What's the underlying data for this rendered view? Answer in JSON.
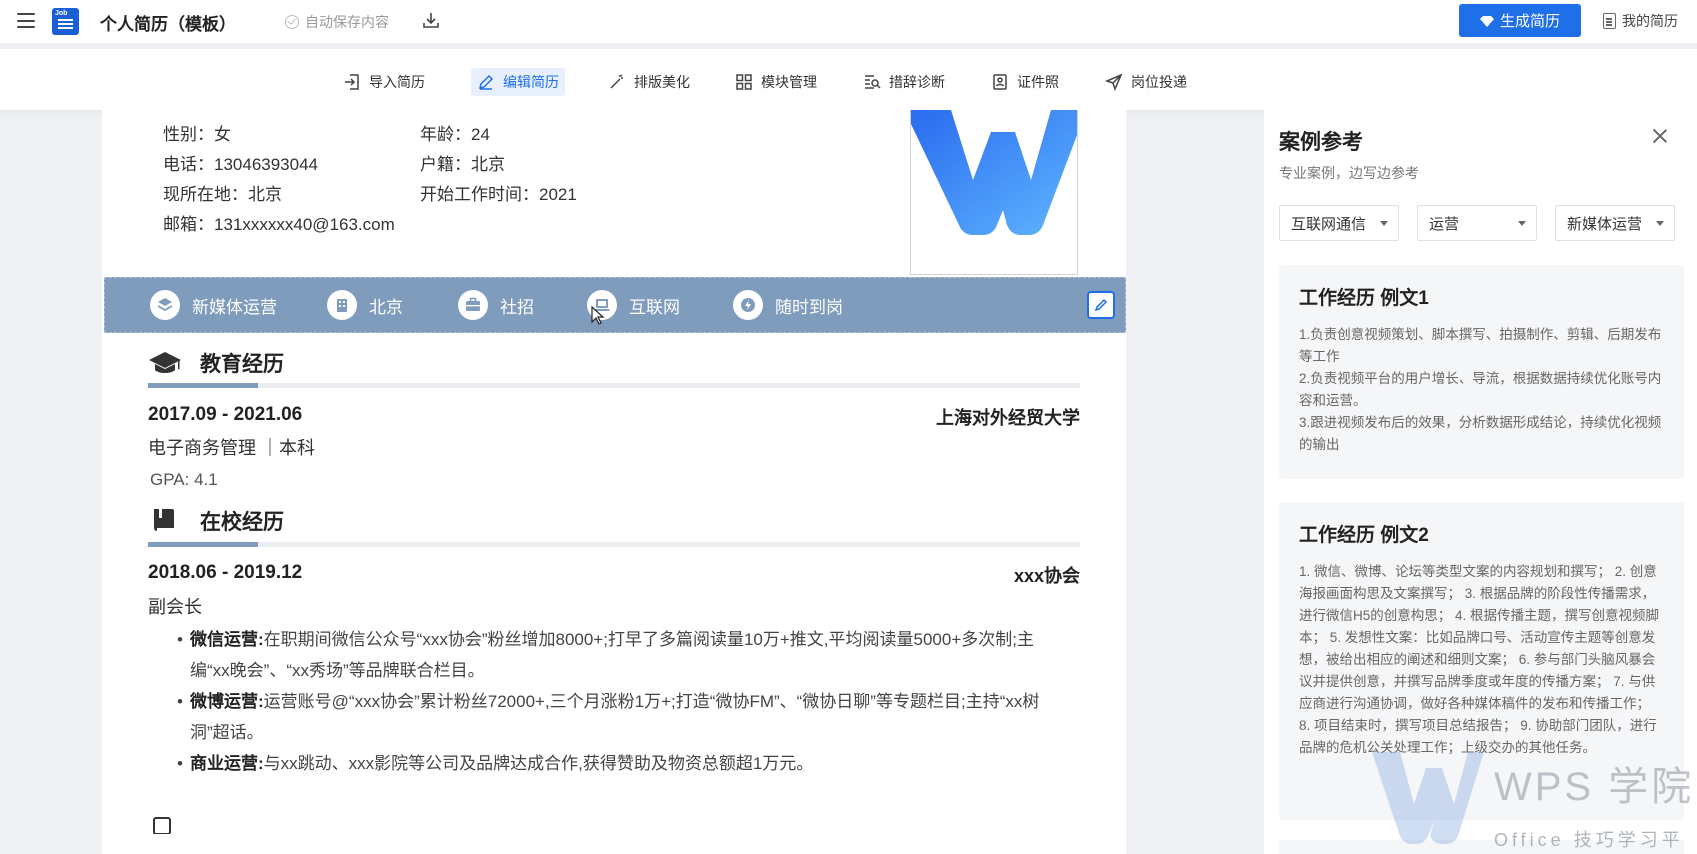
{
  "header": {
    "logo_text": "Job",
    "title": "个人简历（模板）",
    "autosave": "自动保存内容",
    "generate_label": "生成简历",
    "my_resume_label": "我的简历"
  },
  "toolbar": {
    "items": [
      {
        "label": "导入简历",
        "icon": "import-icon"
      },
      {
        "label": "编辑简历",
        "icon": "pencil-icon",
        "active": true
      },
      {
        "label": "排版美化",
        "icon": "magic-wand-icon"
      },
      {
        "label": "模块管理",
        "icon": "grid-icon"
      },
      {
        "label": "措辞诊断",
        "icon": "diagnose-icon"
      },
      {
        "label": "证件照",
        "icon": "id-photo-icon"
      },
      {
        "label": "岗位投递",
        "icon": "send-icon"
      }
    ]
  },
  "profile": {
    "gender": "性别：女",
    "age": "年龄：24",
    "phone": "电话：13046393044",
    "hometown": "户籍：北京",
    "location": "现所在地：北京",
    "work_start": "开始工作时间：2021",
    "email": "邮箱：131xxxxxx40@163.com"
  },
  "tags": [
    {
      "label": "新媒体运营",
      "icon": "layers-icon"
    },
    {
      "label": "北京",
      "icon": "building-icon"
    },
    {
      "label": "社招",
      "icon": "briefcase-icon"
    },
    {
      "label": "互联网",
      "icon": "laptop-icon"
    },
    {
      "label": "随时到岗",
      "icon": "lightning-icon"
    }
  ],
  "education": {
    "title": "教育经历",
    "date": "2017.09  -  2021.06",
    "school": "上海对外经贸大学",
    "major": "电子商务管理  ｜本科",
    "gpa": "GPA: 4.1"
  },
  "campus": {
    "title": "在校经历",
    "date": "2018.06  -  2019.12",
    "org": "xxx协会",
    "role": "副会长",
    "bullets": [
      {
        "head": "微信运营:",
        "text": "在职期间微信公众号“xxx协会”粉丝增加8000+;打早了多篇阅读量10万+推文,平均阅读量5000+多次制;主编“xx晚会”、“xx秀场”等品牌联合栏目。"
      },
      {
        "head": "微博运营:",
        "text": "运营账号@“xxx协会”累计粉丝72000+,三个月涨粉1万+;打造“微协FM”、“微协日聊”等专题栏目;主持“xx树洞”超话。"
      },
      {
        "head": "商业运营:",
        "text": "与xx跳动、xxx影院等公司及品牌达成合作,获得赞助及物资总额超1万元。"
      }
    ]
  },
  "sidebar": {
    "title": "案例参考",
    "subtitle": "专业案例，边写边参考",
    "filters": [
      "互联网通信",
      "运营",
      "新媒体运营"
    ],
    "cards": [
      {
        "title": "工作经历 例文1",
        "body": "1.负责创意视频策划、脚本撰写、拍摄制作、剪辑、后期发布等工作\n2.负责视频平台的用户增长、导流，根据数据持续优化账号内容和运营。\n3.跟进视频发布后的效果，分析数据形成结论，持续优化视频的输出"
      },
      {
        "title": "工作经历 例文2",
        "body": "1. 微信、微博、论坛等类型文案的内容规划和撰写； 2. 创意海报画面构思及文案撰写； 3. 根据品牌的阶段性传播需求，进行微信H5的创意构思； 4. 根据传播主题，撰写创意视频脚本； 5. 发想性文案：比如品牌口号、活动宣传主题等创意发想，被给出相应的阐述和细则文案； 6. 参与部门头脑风暴会议并提供创意，并撰写品牌季度或年度的传播方案； 7. 与供应商进行沟通协调，做好各种媒体稿件的发布和传播工作； 8. 项目结束时，撰写项目总结报告； 9. 协助部门团队，进行品牌的危机公关处理工作；上级交办的其他任务。"
      }
    ]
  },
  "watermark": {
    "brand": "WPS 学院",
    "tagline": "Office 技巧学习平台"
  },
  "colors": {
    "accent": "#1f6fe8",
    "section": "#7f9cbd"
  }
}
